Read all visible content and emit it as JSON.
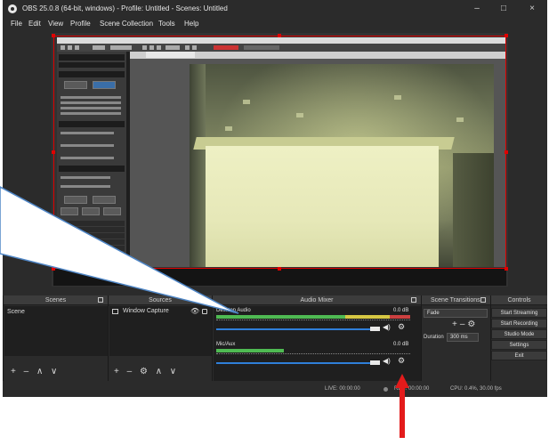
{
  "window": {
    "title": "OBS 25.0.8 (64-bit, windows) - Profile: Untitled - Scenes: Untitled",
    "controls": [
      "–",
      "□",
      "×"
    ]
  },
  "menu": [
    "File",
    "Edit",
    "View",
    "Profile",
    "Scene Collection",
    "Tools",
    "Help"
  ],
  "docks": {
    "scenes": {
      "title": "Scenes",
      "items": [
        "Scene"
      ],
      "toolbar": "+ – ∧ ∨"
    },
    "sources": {
      "title": "Sources",
      "items": [
        "Window Capture"
      ],
      "toolbar": "+ – ⚙ ∧ ∨"
    },
    "audio_mixer": {
      "title": "Audio Mixer",
      "channels": [
        {
          "name": "Desktop Audio",
          "level": "0.0 dB",
          "meter": 0.9,
          "volume": 0.9
        },
        {
          "name": "Mic/Aux",
          "level": "0.0 dB",
          "meter": 0.35,
          "volume": 0.9
        }
      ]
    },
    "scene_transitions": {
      "title": "Scene Transitions",
      "transition": "Fade",
      "duration_label": "Duration",
      "duration": "300 ms"
    },
    "controls": {
      "title": "Controls",
      "buttons": [
        "Start Streaming",
        "Start Recording",
        "Studio Mode",
        "Settings",
        "Exit"
      ]
    }
  },
  "status": {
    "live": "LIVE: 00:00:00",
    "rec": "REC: 00:00:00",
    "cpu": "CPU: 0.4%, 30.00 fps"
  },
  "icons": {
    "app": "obs-logo-icon",
    "speaker": "speaker-icon",
    "gear": "gear-icon",
    "eye": "eye-icon",
    "lock": "lock-icon"
  },
  "colors": {
    "bounding_box": "#e00000",
    "annotation_arrow": "#e31b1b",
    "callout_line": "#4f86c6",
    "meter_green": "#4fba53",
    "volume_blue": "#2f7fd9"
  }
}
